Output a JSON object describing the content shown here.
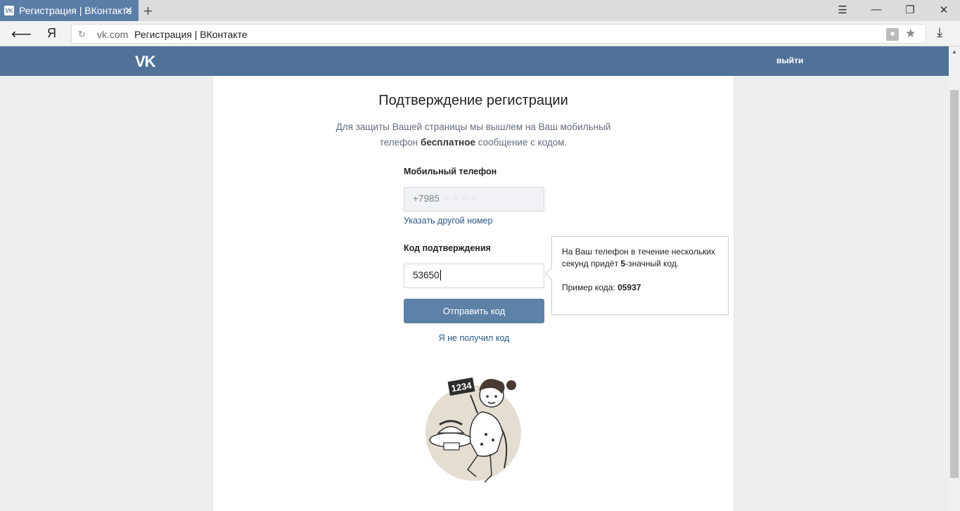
{
  "browser": {
    "tab_title": "Регистрация | ВКонтакте",
    "tab_favicon": "VK",
    "new_tab_label": "+",
    "address_domain": "vk.com",
    "address_title": "Регистрация | ВКонтакте",
    "yandex_button_label": "Я"
  },
  "header": {
    "logo_text": "VK",
    "logout_label": "выйти",
    "bg_color": "#507299"
  },
  "main": {
    "title": "Подтверждение регистрации",
    "description_part1": "Для защиты Вашей страницы мы вышлем на Ваш мобильный телефон ",
    "description_bold": "бесплатное",
    "description_part2": " сообщение с кодом.",
    "phone_label": "Мобильный телефон",
    "phone_value": "+7985 ",
    "change_number_link": "Указать другой номер",
    "code_label": "Код подтверждения",
    "code_value": "53650",
    "submit_label": "Отправить код",
    "not_received_link": "Я не получил код",
    "illustration_number": "1234"
  },
  "tooltip": {
    "line1_part1": "На Ваш телефон в течение нескольких секунд придёт ",
    "line1_bold": "5",
    "line1_part2": "-значный код.",
    "example_label": "Пример кода: ",
    "example_code": "05937"
  },
  "colors": {
    "accent": "#5e81a8",
    "link": "#2a5885"
  },
  "icons": [
    "back-arrow-icon",
    "reload-icon",
    "lock-icon",
    "star-icon",
    "download-icon",
    "menu-icon",
    "minimize-icon",
    "restore-icon",
    "close-icon"
  ]
}
